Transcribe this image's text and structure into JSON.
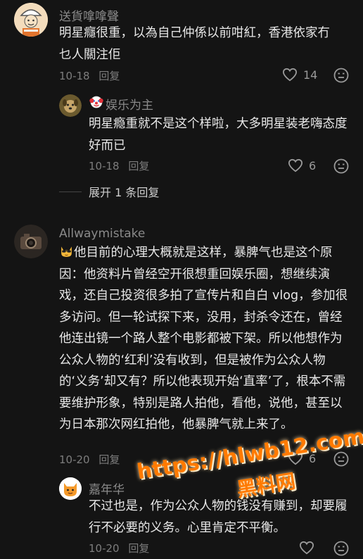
{
  "comments": [
    {
      "username": "送貨嗱嗱聲",
      "text": "明星癮很重，以為自己仲係以前咁紅，香港依家冇乜人關注佢",
      "date": "10-18",
      "reply_label": "回复",
      "likes": "14",
      "avatar_icon": "cartoon-worker-avatar"
    },
    {
      "username": "娱乐为主",
      "badge_icon": "clown-emoji",
      "text": "明星瘾重就不是这个样啦，大多明星装老嗨态度好而已",
      "date": "10-18",
      "reply_label": "回复",
      "likes": "6",
      "avatar_icon": "dog-photo-avatar"
    },
    {
      "expand_label": "展开 1 条回复"
    },
    {
      "username": "Allwaymistake",
      "text": "他目前的心理大概就是这样，暴脾气也是这个原因：他资料片曾经空开很想重回娱乐圈，想继续演戏，还自己投资很多拍了宣传片和自白 vlog，参加很多访问。但一轮试探下来，没用，封杀令还在，曾经他连出镜一个路人整个电影都被下架。所以他想作为公众人物的‘红利’没有收到，但是被作为公众人物的‘义务’却又有？所以他表现开始‘直率’了，根本不需要维护形象，特别是路人拍他，看他，说他，甚至以为日本那次网红拍他，他暴脾气就上来了。",
      "leading_emoji": "cat-sunglasses-emoji",
      "date": "10-20",
      "reply_label": "回复",
      "likes": "6",
      "avatar_icon": "camera-photo-avatar"
    },
    {
      "username": "嘉年华",
      "text": "不过也是，作为公众人物的钱没有赚到，却要履行不必要的义务。心里肯定不平衡。",
      "date": "10-20",
      "reply_label": "回复",
      "likes": "",
      "avatar_icon": "cat-emoji-avatar"
    }
  ],
  "watermark": {
    "url": "https://hlwb12.com",
    "name": "黑料网"
  },
  "colors": {
    "background": "#141414",
    "username": "#8a8a8a",
    "text": "#e8e8e8",
    "meta": "#7d7d7d",
    "watermark": "#ff7a00"
  }
}
